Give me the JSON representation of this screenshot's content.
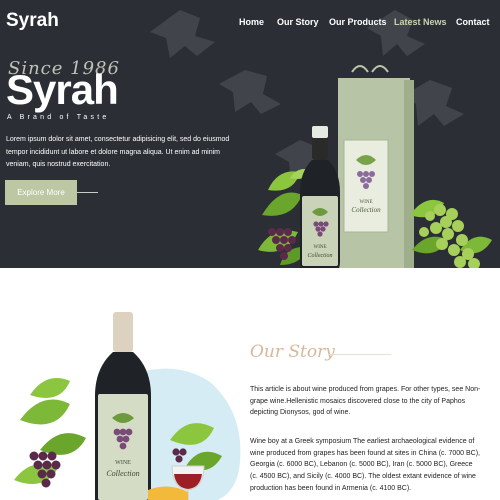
{
  "header": {
    "logo": "Syrah",
    "nav": [
      {
        "label": "Home",
        "active": false
      },
      {
        "label": "Our Story",
        "active": false
      },
      {
        "label": "Our Products",
        "active": false
      },
      {
        "label": "Latest News",
        "active": true
      },
      {
        "label": "Contact",
        "active": false
      }
    ]
  },
  "hero": {
    "since": "Since 1986",
    "title": "Syrah",
    "tagline": "A Brand of Taste",
    "lorem": "Lorem ipsum dolor sit amet, consectetur adipisicing elit, sed do eiusmod tempor incididunt ut labore et dolore magna aliqua. Ut enim ad minim veniam, quis nostrud exercitation.",
    "button": "Explore More",
    "bottle_label_top": "WINE",
    "bottle_label_bottom": "Collection",
    "bag_label_top": "WINE",
    "bag_label_bottom": "Collection"
  },
  "story": {
    "title": "Our Story",
    "p1": "This article is about wine produced from grapes. For other types, see Non-grape wine.Hellenistic mosaics discovered close to the city of Paphos depicting Dionysos, god of wine.",
    "p2": "Wine boy at a Greek symposium The earliest archaeological evidence of wine produced from grapes has been found at sites in China (c. 7000 BC), Georgia (c. 6000 BC), Lebanon (c. 5000 BC), Iran (c. 5000 BC), Greece (c. 4500 BC), and Sicily (c. 4000 BC). The oldest extant evidence of wine production has been found in Armenia (c. 4100 BC).",
    "bottle_label_top": "WINE",
    "bottle_label_bottom": "Collection"
  },
  "colors": {
    "hero_bg": "#2b2f35",
    "accent_green": "#bcc7a4",
    "accent_tan": "#d6b89a",
    "active_nav": "#c9d3b0"
  }
}
